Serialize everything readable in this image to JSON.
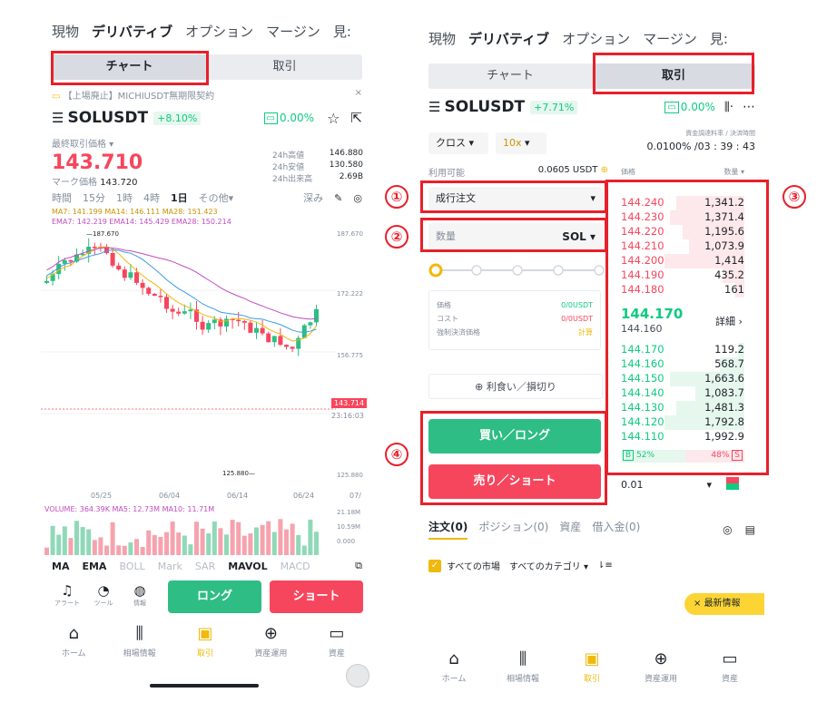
{
  "left": {
    "topnav": [
      "現物",
      "デリバティブ",
      "オプション",
      "マージン",
      "見:"
    ],
    "segment": [
      "チャート",
      "取引"
    ],
    "notice": "【上場廃止】MICHIUSDT無期限契約",
    "symbol": "SOLUSDT",
    "change_pct": "+8.10%",
    "funding": "0.00%",
    "last_price_label": "最終取引価格",
    "last_price": "143.710",
    "mark_price_label": "マーク価格",
    "mark_price": "143.720",
    "stats": [
      {
        "label": "24h高値",
        "value": "146.880"
      },
      {
        "label": "24h安値",
        "value": "130.580"
      },
      {
        "label": "24h出来高",
        "value": "2.69B"
      }
    ],
    "intervals": [
      "時間",
      "15分",
      "1時",
      "4時",
      "1日",
      "その他"
    ],
    "depth_label": "深み",
    "ma_line1": "MA7: 141.199  MA14: 146.111  MA28: 151.423",
    "ma_line2": "EMA7: 142.219  EMA14: 145.429  EMA28: 150.214",
    "high_marker": "187.670",
    "low_marker": "125.880",
    "yaxis": [
      "187.670",
      "172.222",
      "156.775",
      "125.880"
    ],
    "current_tag": "143.714",
    "countdown_tag": "23:16:03",
    "xaxis": [
      "05/25",
      "06/04",
      "06/14",
      "06/24",
      "07/"
    ],
    "volume_line": "VOLUME: 364.39K  MA5: 12.73M  MA10: 11.71M",
    "vol_axis": [
      "21.18M",
      "10.59M",
      "0.000"
    ],
    "indicators": [
      "MA",
      "EMA",
      "BOLL",
      "Mark",
      "SAR",
      "MAVOL",
      "MACD"
    ],
    "tools": [
      "アラート",
      "ツール",
      "情報"
    ],
    "long_btn": "ロング",
    "short_btn": "ショート",
    "tabbar": [
      "ホーム",
      "相場情報",
      "取引",
      "資産運用",
      "資産"
    ]
  },
  "right": {
    "topnav": [
      "現物",
      "デリバティブ",
      "オプション",
      "マージン",
      "見:"
    ],
    "segment": [
      "チャート",
      "取引"
    ],
    "symbol": "SOLUSDT",
    "change_pct": "+7.71%",
    "funding": "0.00%",
    "margin_mode": "クロス",
    "leverage": "10x",
    "funding_label": "資金調達料率 / 決済時間",
    "funding_value": "0.0100% /03 : 39 : 43",
    "avail_label": "利用可能",
    "avail_value": "0.0605 USDT",
    "order_type": "成行注文",
    "qty_placeholder": "数量",
    "qty_unit": "SOL",
    "cost_rows": [
      {
        "label": "価格",
        "value": "0/0USDT"
      },
      {
        "label": "コスト",
        "value": "0/0USDT"
      },
      {
        "label": "強制決済価格",
        "value": "計算"
      }
    ],
    "tpsl": "利食い／損切り",
    "buy_btn": "買い／ロング",
    "sell_btn": "売り／ショート",
    "ob_header": [
      "価格",
      "数量"
    ],
    "asks": [
      {
        "price": "144.240",
        "qty": "1,341.2",
        "depth": 0.55
      },
      {
        "price": "144.230",
        "qty": "1,371.4",
        "depth": 0.6
      },
      {
        "price": "144.220",
        "qty": "1,195.6",
        "depth": 0.5
      },
      {
        "price": "144.210",
        "qty": "1,073.9",
        "depth": 0.45
      },
      {
        "price": "144.200",
        "qty": "1,414",
        "depth": 0.65
      },
      {
        "price": "144.190",
        "qty": "435.2",
        "depth": 0.18
      },
      {
        "price": "144.180",
        "qty": "161",
        "depth": 0.07
      }
    ],
    "mid_price": "144.170",
    "mid_mark": "144.160",
    "detail_link": "詳細",
    "bids": [
      {
        "price": "144.170",
        "qty": "119.2",
        "depth": 0.05
      },
      {
        "price": "144.160",
        "qty": "568.7",
        "depth": 0.2
      },
      {
        "price": "144.150",
        "qty": "1,663.6",
        "depth": 0.6
      },
      {
        "price": "144.140",
        "qty": "1,083.7",
        "depth": 0.4
      },
      {
        "price": "144.130",
        "qty": "1,481.3",
        "depth": 0.55
      },
      {
        "price": "144.120",
        "qty": "1,792.8",
        "depth": 0.65
      },
      {
        "price": "144.110",
        "qty": "1,992.9",
        "depth": 0.0
      }
    ],
    "bid_pct": "52%",
    "ask_pct": "48%",
    "bid_pct_value": 0.52,
    "ask_pct_value": 0.48,
    "bid_letter": "B",
    "ask_letter": "S",
    "tick_size": "0.01",
    "bottom_tabs": [
      "注文(0)",
      "ポジション(0)",
      "資産",
      "借入金(0)"
    ],
    "filter_all_markets": "すべての市場",
    "filter_all_categories": "すべてのカテゴリ",
    "news_badge": "最新情報",
    "tabbar": [
      "ホーム",
      "相場情報",
      "取引",
      "資産運用",
      "資産"
    ]
  },
  "annotations": [
    "①",
    "②",
    "③",
    "④"
  ],
  "colors": {
    "green": "#0ecb81",
    "red": "#f6465d",
    "highlight": "#e8202a",
    "accent": "#f0b90b"
  }
}
